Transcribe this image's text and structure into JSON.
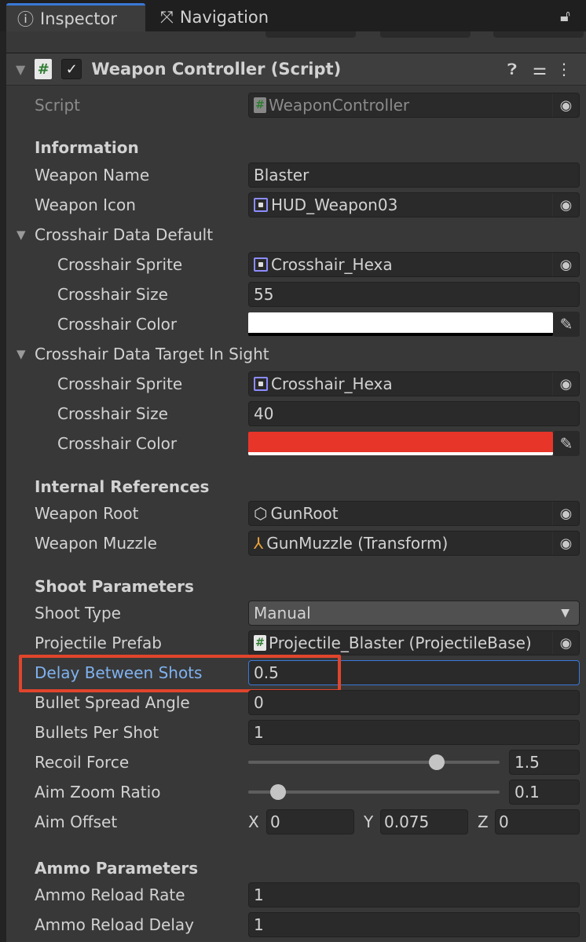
{
  "tabs": [
    {
      "label": "Inspector",
      "icon": "info-icon"
    },
    {
      "label": "Navigation",
      "icon": "navigation-icon"
    }
  ],
  "component": {
    "title": "Weapon Controller (Script)",
    "enabled": true
  },
  "script": {
    "label": "Script",
    "value": "WeaponController"
  },
  "information": {
    "header": "Information",
    "weapon_name": {
      "label": "Weapon Name",
      "value": "Blaster"
    },
    "weapon_icon": {
      "label": "Weapon Icon",
      "value": "HUD_Weapon03"
    }
  },
  "crosshair_default": {
    "header": "Crosshair Data Default",
    "sprite": {
      "label": "Crosshair Sprite",
      "value": "Crosshair_Hexa"
    },
    "size": {
      "label": "Crosshair Size",
      "value": "55"
    },
    "color": {
      "label": "Crosshair Color",
      "value": "#ffffff"
    }
  },
  "crosshair_target": {
    "header": "Crosshair Data Target In Sight",
    "sprite": {
      "label": "Crosshair Sprite",
      "value": "Crosshair_Hexa"
    },
    "size": {
      "label": "Crosshair Size",
      "value": "40"
    },
    "color": {
      "label": "Crosshair Color",
      "value": "#e8352a"
    }
  },
  "internal": {
    "header": "Internal References",
    "root": {
      "label": "Weapon Root",
      "value": "GunRoot"
    },
    "muzzle": {
      "label": "Weapon Muzzle",
      "value": "GunMuzzle (Transform)"
    }
  },
  "shoot": {
    "header": "Shoot Parameters",
    "type": {
      "label": "Shoot Type",
      "value": "Manual"
    },
    "prefab": {
      "label": "Projectile Prefab",
      "value": "Projectile_Blaster (ProjectileBase)"
    },
    "delay": {
      "label": "Delay Between Shots",
      "value": "0.5"
    },
    "spread": {
      "label": "Bullet Spread Angle",
      "value": "0"
    },
    "bullets": {
      "label": "Bullets Per Shot",
      "value": "1"
    },
    "recoil": {
      "label": "Recoil Force",
      "value": "1.5",
      "slider_fraction": 0.75
    },
    "zoom": {
      "label": "Aim Zoom Ratio",
      "value": "0.1",
      "slider_fraction": 0.12
    },
    "offset": {
      "label": "Aim Offset",
      "x_label": "X",
      "x": "0",
      "y_label": "Y",
      "y": "0.075",
      "z_label": "Z",
      "z": "0"
    }
  },
  "ammo": {
    "header": "Ammo Parameters",
    "rate": {
      "label": "Ammo Reload Rate",
      "value": "1"
    },
    "delay": {
      "label": "Ammo Reload Delay",
      "value": "1"
    }
  }
}
